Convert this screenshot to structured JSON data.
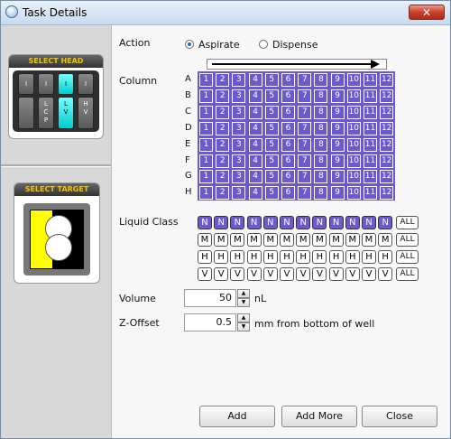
{
  "window": {
    "title": "Task Details",
    "close_glyph": "✕"
  },
  "sidebar": {
    "select_head": {
      "label": "SELECT HEAD",
      "heads": [
        {
          "top": "I",
          "bottom": [
            "",
            ""
          ],
          "selected": false
        },
        {
          "top": "I",
          "bottom": [
            "L",
            "C",
            "P"
          ],
          "selected": false
        },
        {
          "top": "I",
          "bottom": [
            "L",
            "V"
          ],
          "selected": true
        },
        {
          "top": "I",
          "bottom": [
            "H",
            "V"
          ],
          "selected": false
        }
      ]
    },
    "select_target": {
      "label": "SELECT TARGET"
    }
  },
  "action": {
    "label": "Action",
    "options": [
      {
        "label": "Aspirate",
        "selected": true
      },
      {
        "label": "Dispense",
        "selected": false
      }
    ]
  },
  "column": {
    "label": "Column",
    "rows": [
      "A",
      "B",
      "C",
      "D",
      "E",
      "F",
      "G",
      "H"
    ],
    "columns": [
      "1",
      "2",
      "3",
      "4",
      "5",
      "6",
      "7",
      "8",
      "9",
      "10",
      "11",
      "12"
    ]
  },
  "liquid_class": {
    "label": "Liquid Class",
    "rows": [
      {
        "letter": "N",
        "selected": true
      },
      {
        "letter": "M",
        "selected": false
      },
      {
        "letter": "H",
        "selected": false
      },
      {
        "letter": "V",
        "selected": false
      }
    ],
    "all_label": "ALL"
  },
  "volume": {
    "label": "Volume",
    "value": "50",
    "unit": "nL"
  },
  "z_offset": {
    "label": "Z-Offset",
    "value": "0.5",
    "unit": "mm from bottom of well"
  },
  "buttons": {
    "add": "Add",
    "add_more": "Add More",
    "close": "Close"
  },
  "colors": {
    "well": "#6a5acd",
    "selected_head": "#00cccc",
    "target_yellow": "#ffff00"
  }
}
